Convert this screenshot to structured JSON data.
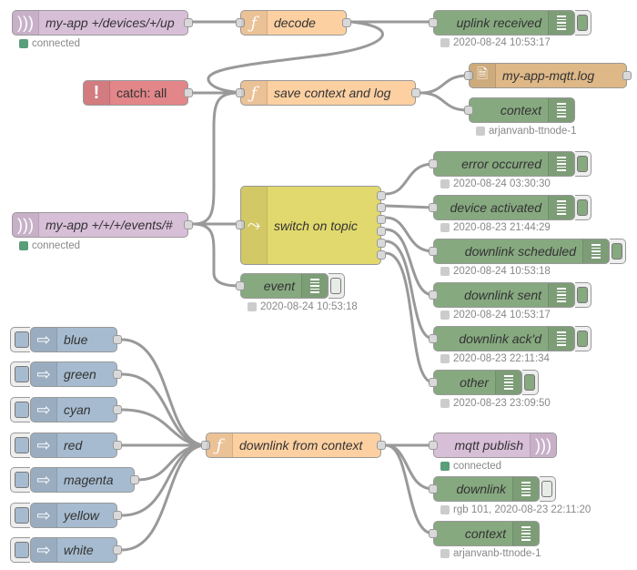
{
  "nodes": {
    "mqtt_in_up": {
      "label": "my-app +/devices/+/up",
      "icon": "mqtt-wave-icon",
      "status": "connected"
    },
    "catch_all": {
      "label": "catch: all",
      "icon": "exclamation-icon"
    },
    "decode": {
      "label": "decode",
      "icon": "function-icon"
    },
    "save_context_log": {
      "label": "save context and log",
      "icon": "function-icon"
    },
    "uplink_received": {
      "label": "uplink received",
      "status": "2020-08-24 10:53:17"
    },
    "file_log": {
      "label": "my-app-mqtt.log",
      "icon": "file-icon"
    },
    "context_top": {
      "label": "context",
      "status": "arjanvanb-ttnode-1"
    },
    "mqtt_in_events": {
      "label": "my-app +/+/+/events/#",
      "icon": "mqtt-wave-icon",
      "status": "connected"
    },
    "switch_topic": {
      "label": "switch on topic",
      "icon": "switch-icon"
    },
    "event": {
      "label": "event",
      "status": "2020-08-24 10:53:18"
    },
    "error_occurred": {
      "label": "error occurred",
      "status": "2020-08-24 03:30:30"
    },
    "device_activated": {
      "label": "device activated",
      "status": "2020-08-23 21:44:29"
    },
    "downlink_scheduled": {
      "label": "downlink scheduled",
      "status": "2020-08-24 10:53:18"
    },
    "downlink_sent": {
      "label": "downlink sent",
      "status": "2020-08-24 10:53:17"
    },
    "downlink_ackd": {
      "label": "downlink ack'd",
      "status": "2020-08-23 22:11:34"
    },
    "other": {
      "label": "other",
      "status": "2020-08-23 23:09:50"
    },
    "downlink_from_context": {
      "label": "downlink from context",
      "icon": "function-icon"
    },
    "mqtt_publish": {
      "label": "mqtt publish",
      "icon": "mqtt-wave-icon",
      "status": "connected"
    },
    "downlink_debug": {
      "label": "downlink",
      "status": "rgb 101, 2020-08-23 22:11:20"
    },
    "context_bottom": {
      "label": "context",
      "status": "arjanvanb-ttnode-1"
    }
  },
  "injects": [
    {
      "label": "blue"
    },
    {
      "label": "green"
    },
    {
      "label": "cyan"
    },
    {
      "label": "red"
    },
    {
      "label": "magenta"
    },
    {
      "label": "yellow"
    },
    {
      "label": "white"
    }
  ]
}
